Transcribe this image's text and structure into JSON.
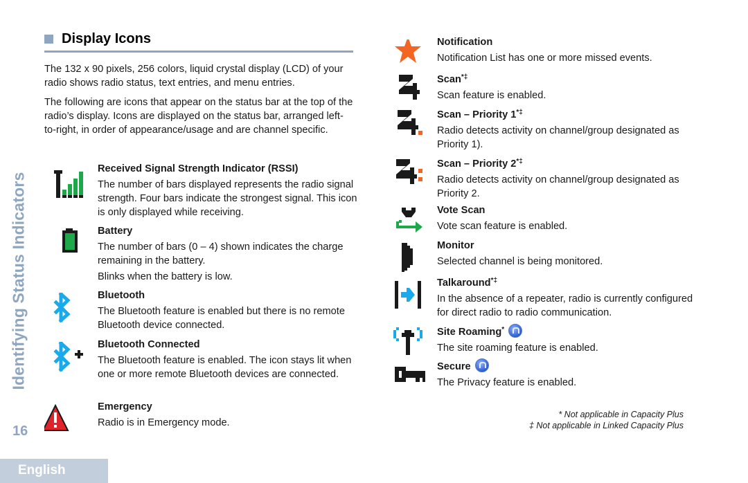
{
  "sidebar": {
    "section_title": "Identifying Status Indicators",
    "page_number": "16",
    "language_tab": "English"
  },
  "section": {
    "title": "Display Icons",
    "intro": [
      "The 132 x 90 pixels, 256 colors, liquid crystal display (LCD) of your radio shows radio status, text entries, and menu entries.",
      "The following are icons that appear on the status bar at the top of the radio’s display. Icons are displayed on the status bar, arranged left-to-right, in order of appearance/usage and are channel specific."
    ]
  },
  "colors": {
    "accent": "#8fa6c0",
    "signal_green": "#1fa84a",
    "bluetooth_blue": "#1aa9ea",
    "emergency_red": "#e0242b",
    "notification_orange": "#f26522",
    "icon_black": "#1a1a1a"
  },
  "icons_left": [
    {
      "icon": "rssi-icon",
      "title": "Received Signal Strength Indicator (RSSI)",
      "marks": "",
      "description": "The number of bars displayed represents the radio signal strength. Four bars indicate the strongest signal. This icon is only displayed while receiving.",
      "note": ""
    },
    {
      "icon": "battery-icon",
      "title": "Battery",
      "marks": "",
      "description": "The number of bars (0 – 4) shown indicates the charge remaining in the battery.",
      "note": "Blinks when the battery is low."
    },
    {
      "icon": "bluetooth-icon",
      "title": "Bluetooth",
      "marks": "",
      "description": "The Bluetooth feature is enabled but there is no remote Bluetooth device connected.",
      "note": ""
    },
    {
      "icon": "bluetooth-connected-icon",
      "title": "Bluetooth Connected",
      "marks": "",
      "description": "The Bluetooth feature is enabled. The icon stays lit when one or more remote Bluetooth devices are connected.",
      "note": ""
    },
    {
      "icon": "emergency-icon",
      "title": "Emergency",
      "marks": "",
      "description": "Radio is in Emergency mode.",
      "note": ""
    }
  ],
  "icons_right": [
    {
      "icon": "notification-icon",
      "title": "Notification",
      "marks": "",
      "description": "Notification List has one or more missed events.",
      "badge": false
    },
    {
      "icon": "scan-icon",
      "title": "Scan",
      "marks": "*‡",
      "description": "Scan feature is enabled.",
      "badge": false
    },
    {
      "icon": "scan-priority-1-icon",
      "title": "Scan – Priority 1",
      "marks": "*‡",
      "description": "Radio detects activity on channel/group designated as Priority 1).",
      "badge": false
    },
    {
      "icon": "scan-priority-2-icon",
      "title": "Scan – Priority 2",
      "marks": "*‡",
      "description": "Radio detects activity on channel/group designated as Priority 2.",
      "badge": false
    },
    {
      "icon": "vote-scan-icon",
      "title": "Vote Scan",
      "marks": "",
      "description": "Vote scan feature is enabled.",
      "badge": false
    },
    {
      "icon": "monitor-icon",
      "title": "Monitor",
      "marks": "",
      "description": "Selected channel is being monitored.",
      "badge": false
    },
    {
      "icon": "talkaround-icon",
      "title": "Talkaround",
      "marks": "*‡",
      "description": "In the absence of a repeater, radio is currently configured for direct radio to radio communication.",
      "badge": false
    },
    {
      "icon": "site-roaming-icon",
      "title": "Site Roaming",
      "marks": "*",
      "description": "The site roaming feature is enabled.",
      "badge": true
    },
    {
      "icon": "secure-icon",
      "title": "Secure",
      "marks": "",
      "description": "The Privacy feature is enabled.",
      "badge": true
    }
  ],
  "footnotes": [
    "* Not applicable in Capacity Plus",
    "‡ Not applicable in Linked Capacity Plus"
  ]
}
